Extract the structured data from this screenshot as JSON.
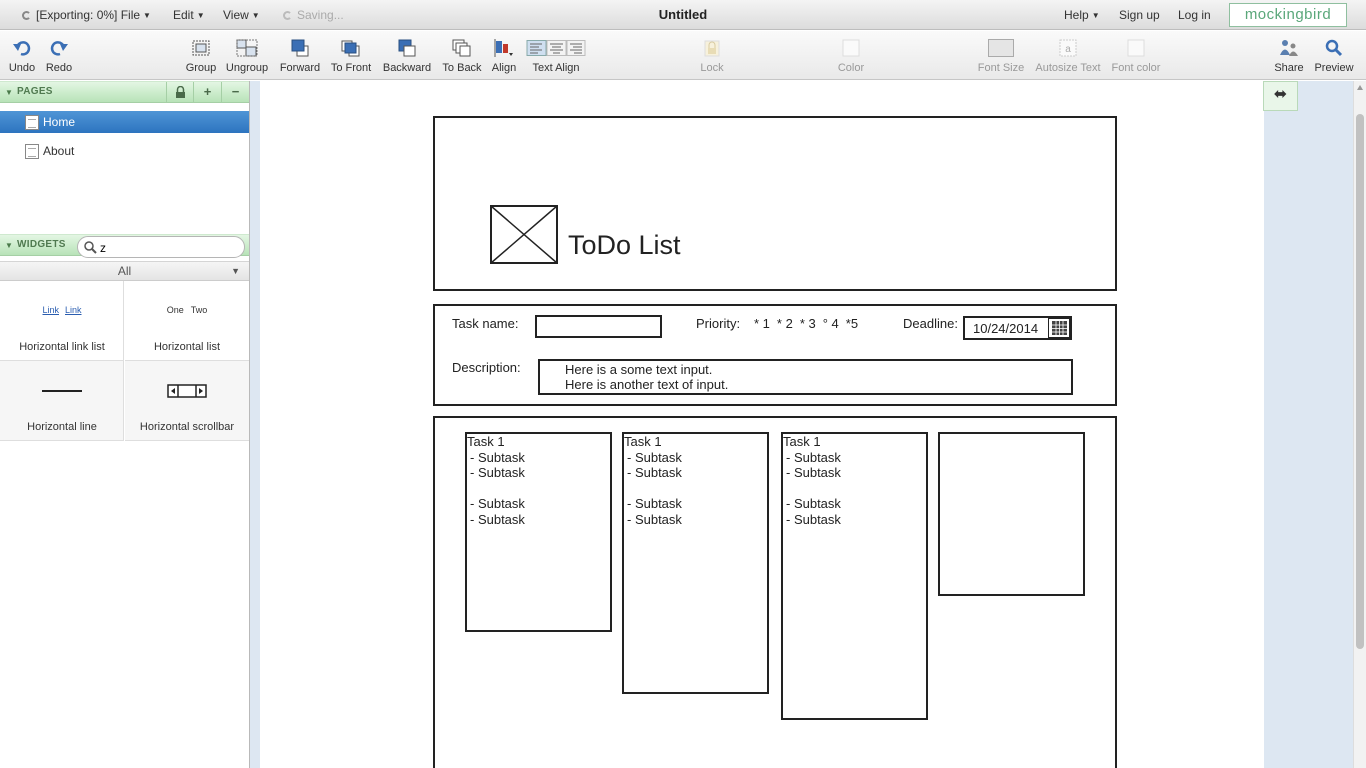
{
  "menubar": {
    "file_label": "[Exporting: 0%] File",
    "edit_label": "Edit",
    "view_label": "View",
    "saving_label": "Saving...",
    "title": "Untitled",
    "help_label": "Help",
    "signup_label": "Sign up",
    "login_label": "Log in",
    "brand": "mockingbird"
  },
  "toolbar": {
    "undo": "Undo",
    "redo": "Redo",
    "group": "Group",
    "ungroup": "Ungroup",
    "forward": "Forward",
    "to_front": "To Front",
    "backward": "Backward",
    "to_back": "To Back",
    "align": "Align",
    "text_align": "Text Align",
    "lock": "Lock",
    "color": "Color",
    "font_size": "Font Size",
    "autosize_text": "Autosize Text",
    "font_color": "Font color",
    "share": "Share",
    "preview": "Preview"
  },
  "pages_panel": {
    "title": "PAGES",
    "pages": [
      {
        "name": "Home",
        "selected": true
      },
      {
        "name": "About",
        "selected": false
      }
    ]
  },
  "widgets_panel": {
    "title": "WIDGETS",
    "search_value": "z",
    "filter": "All",
    "items": [
      {
        "label": "Horizontal link list",
        "preview": [
          "Link",
          "Link"
        ]
      },
      {
        "label": "Horizontal list",
        "preview": [
          "One",
          "Two"
        ]
      },
      {
        "label": "Horizontal line"
      },
      {
        "label": "Horizontal scrollbar"
      }
    ]
  },
  "mockup": {
    "header_title": "ToDo List",
    "form": {
      "task_name_label": "Task name:",
      "priority_label": "Priority:",
      "priority_options": [
        "* 1",
        "* 2",
        "* 3",
        "° 4",
        "*5"
      ],
      "deadline_label": "Deadline:",
      "deadline_value": "10/24/2014",
      "description_label": "Description:",
      "description_line1": "Here is a some text input.",
      "description_line2": "Here is another text of input."
    },
    "columns": [
      {
        "title": "Task 1",
        "lines": [
          "- Subtask",
          "- Subtask",
          "",
          "- Subtask",
          "- Subtask"
        ]
      },
      {
        "title": "Task 1",
        "lines": [
          "- Subtask",
          "- Subtask",
          "",
          "- Subtask",
          "- Subtask"
        ]
      },
      {
        "title": "Task 1",
        "lines": [
          "- Subtask",
          "- Subtask",
          "",
          "- Subtask",
          "- Subtask"
        ]
      }
    ]
  },
  "colors": {
    "accent_green": "#b8e3b8",
    "selection_blue": "#2d74bf",
    "canvas_gutter": "#dde7f2",
    "brand_green": "#5aa77a"
  }
}
